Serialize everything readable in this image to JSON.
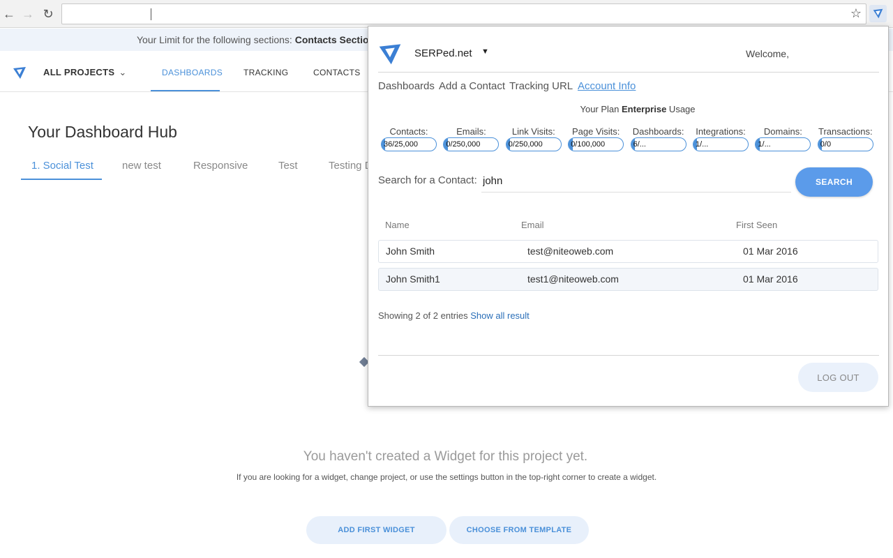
{
  "browser": {
    "url": "",
    "icons": {
      "back": "back-arrow-icon",
      "forward": "forward-arrow-icon",
      "reload": "reload-icon",
      "bookmark": "star-icon",
      "extension": "serped-logo-icon"
    }
  },
  "app": {
    "limit_bar": {
      "prefix": "Your Limit for the following sections: ",
      "sections": "Contacts Section"
    },
    "nav": {
      "projects_label": "ALL PROJECTS",
      "links": [
        "DASHBOARDS",
        "TRACKING",
        "CONTACTS"
      ],
      "active": "DASHBOARDS"
    },
    "hub_title": "Your Dashboard Hub",
    "tabs": [
      "1. Social Test",
      "new test",
      "Responsive",
      "Test",
      "Testing D"
    ],
    "empty_state": {
      "title": "You haven't created a Widget for this project yet.",
      "subtitle": "If you are looking for a widget, change project, or use the settings button in the top-right corner to create a widget.",
      "add_button": "ADD FIRST WIDGET",
      "template_button": "CHOOSE FROM TEMPLATE"
    },
    "accent_color": "#4a90d9"
  },
  "popup": {
    "brand": "SERPed.net",
    "brand_caret": "▼",
    "welcome": "Welcome,",
    "links": [
      "Dashboards",
      "Add a Contact",
      "Tracking URL",
      "Account Info"
    ],
    "active_link": "Account Info",
    "plan": {
      "prefix": "Your Plan ",
      "name": "Enterprise",
      "suffix": " Usage"
    },
    "usage": [
      {
        "label": "Contacts:",
        "value": "36/25,000",
        "fraction": 0.0014
      },
      {
        "label": "Emails:",
        "value": "0/250,000",
        "fraction": 0
      },
      {
        "label": "Link Visits:",
        "value": "0/250,000",
        "fraction": 0
      },
      {
        "label": "Page Visits:",
        "value": "0/100,000",
        "fraction": 0
      },
      {
        "label": "Dashboards:",
        "value": "6/...",
        "fraction": 0
      },
      {
        "label": "Integrations:",
        "value": "1/...",
        "fraction": 0
      },
      {
        "label": "Domains:",
        "value": "1/...",
        "fraction": 0
      },
      {
        "label": "Transactions:",
        "value": "0/0",
        "fraction": 0
      }
    ],
    "search": {
      "label": "Search for a Contact:",
      "value": "john",
      "button": "SEARCH"
    },
    "table": {
      "columns": [
        "Name",
        "Email",
        "First Seen"
      ],
      "rows": [
        {
          "name": "John Smith",
          "email": "test@niteoweb.com",
          "first_seen": "01 Mar 2016"
        },
        {
          "name": "John Smith1",
          "email": "test1@niteoweb.com",
          "first_seen": "01 Mar 2016"
        }
      ]
    },
    "showing": {
      "text": "Showing 2 of 2 entries ",
      "link": "Show all result"
    },
    "logout": "LOG OUT"
  }
}
